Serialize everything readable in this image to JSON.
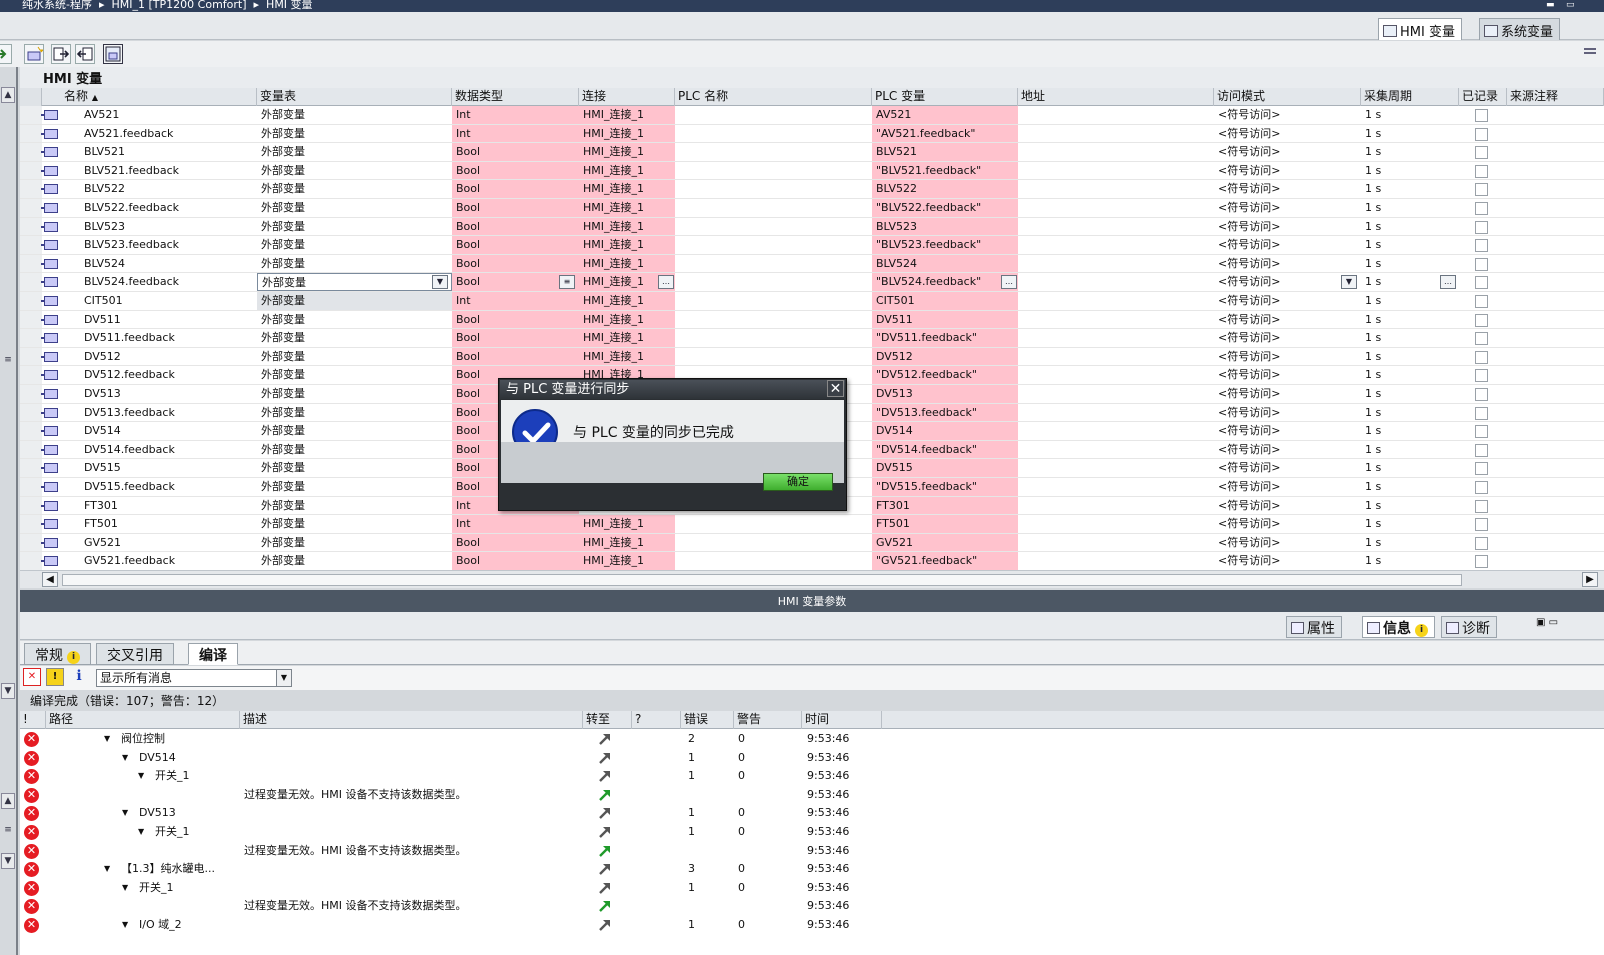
{
  "breadcrumb": [
    "纯水系统-程序",
    "HMI_1 [TP1200 Comfort]",
    "HMI 变量"
  ],
  "top_tabs": [
    "HMI 变量",
    "系统变量"
  ],
  "grid": {
    "title": "HMI 变量",
    "columns": [
      "名称",
      "变量表",
      "数据类型",
      "连接",
      "PLC 名称",
      "PLC 变量",
      "地址",
      "访问模式",
      "采集周期",
      "已记录",
      "来源注释"
    ],
    "sort_indicator": "▲",
    "rows": [
      {
        "name": "AV521",
        "table": "外部变量",
        "type": "Int",
        "conn": "HMI_连接_1",
        "plcvar": "AV521",
        "access": "<符号访问>",
        "cycle": "1 s"
      },
      {
        "name": "AV521.feedback",
        "table": "外部变量",
        "type": "Int",
        "conn": "HMI_连接_1",
        "plcvar": "\"AV521.feedback\"",
        "access": "<符号访问>",
        "cycle": "1 s"
      },
      {
        "name": "BLV521",
        "table": "外部变量",
        "type": "Bool",
        "conn": "HMI_连接_1",
        "plcvar": "BLV521",
        "access": "<符号访问>",
        "cycle": "1 s"
      },
      {
        "name": "BLV521.feedback",
        "table": "外部变量",
        "type": "Bool",
        "conn": "HMI_连接_1",
        "plcvar": "\"BLV521.feedback\"",
        "access": "<符号访问>",
        "cycle": "1 s"
      },
      {
        "name": "BLV522",
        "table": "外部变量",
        "type": "Bool",
        "conn": "HMI_连接_1",
        "plcvar": "BLV522",
        "access": "<符号访问>",
        "cycle": "1 s"
      },
      {
        "name": "BLV522.feedback",
        "table": "外部变量",
        "type": "Bool",
        "conn": "HMI_连接_1",
        "plcvar": "\"BLV522.feedback\"",
        "access": "<符号访问>",
        "cycle": "1 s"
      },
      {
        "name": "BLV523",
        "table": "外部变量",
        "type": "Bool",
        "conn": "HMI_连接_1",
        "plcvar": "BLV523",
        "access": "<符号访问>",
        "cycle": "1 s"
      },
      {
        "name": "BLV523.feedback",
        "table": "外部变量",
        "type": "Bool",
        "conn": "HMI_连接_1",
        "plcvar": "\"BLV523.feedback\"",
        "access": "<符号访问>",
        "cycle": "1 s"
      },
      {
        "name": "BLV524",
        "table": "外部变量",
        "type": "Bool",
        "conn": "HMI_连接_1",
        "plcvar": "BLV524",
        "access": "<符号访问>",
        "cycle": "1 s"
      },
      {
        "name": "BLV524.feedback",
        "table": "外部变量",
        "type": "Bool",
        "conn": "HMI_连接_1",
        "plcvar": "\"BLV524.feedback\"",
        "access": "<符号访问>",
        "cycle": "1 s",
        "selected": true
      },
      {
        "name": "CIT501",
        "table": "外部变量",
        "type": "Int",
        "conn": "HMI_连接_1",
        "plcvar": "CIT501",
        "access": "<符号访问>",
        "cycle": "1 s"
      },
      {
        "name": "DV511",
        "table": "外部变量",
        "type": "Bool",
        "conn": "HMI_连接_1",
        "plcvar": "DV511",
        "access": "<符号访问>",
        "cycle": "1 s"
      },
      {
        "name": "DV511.feedback",
        "table": "外部变量",
        "type": "Bool",
        "conn": "HMI_连接_1",
        "plcvar": "\"DV511.feedback\"",
        "access": "<符号访问>",
        "cycle": "1 s"
      },
      {
        "name": "DV512",
        "table": "外部变量",
        "type": "Bool",
        "conn": "HMI_连接_1",
        "plcvar": "DV512",
        "access": "<符号访问>",
        "cycle": "1 s"
      },
      {
        "name": "DV512.feedback",
        "table": "外部变量",
        "type": "Bool",
        "conn": "HMI_连接_1",
        "plcvar": "\"DV512.feedback\"",
        "access": "<符号访问>",
        "cycle": "1 s"
      },
      {
        "name": "DV513",
        "table": "外部变量",
        "type": "Bool",
        "conn": "",
        "plcvar": "DV513",
        "access": "<符号访问>",
        "cycle": "1 s"
      },
      {
        "name": "DV513.feedback",
        "table": "外部变量",
        "type": "Bool",
        "conn": "",
        "plcvar": "\"DV513.feedback\"",
        "access": "<符号访问>",
        "cycle": "1 s"
      },
      {
        "name": "DV514",
        "table": "外部变量",
        "type": "Bool",
        "conn": "",
        "plcvar": "DV514",
        "access": "<符号访问>",
        "cycle": "1 s"
      },
      {
        "name": "DV514.feedback",
        "table": "外部变量",
        "type": "Bool",
        "conn": "",
        "plcvar": "\"DV514.feedback\"",
        "access": "<符号访问>",
        "cycle": "1 s"
      },
      {
        "name": "DV515",
        "table": "外部变量",
        "type": "Bool",
        "conn": "",
        "plcvar": "DV515",
        "access": "<符号访问>",
        "cycle": "1 s"
      },
      {
        "name": "DV515.feedback",
        "table": "外部变量",
        "type": "Bool",
        "conn": "",
        "plcvar": "\"DV515.feedback\"",
        "access": "<符号访问>",
        "cycle": "1 s"
      },
      {
        "name": "FT301",
        "table": "外部变量",
        "type": "Int",
        "conn": "",
        "plcvar": "FT301",
        "access": "<符号访问>",
        "cycle": "1 s"
      },
      {
        "name": "FT501",
        "table": "外部变量",
        "type": "Int",
        "conn": "HMI_连接_1",
        "plcvar": "FT501",
        "access": "<符号访问>",
        "cycle": "1 s"
      },
      {
        "name": "GV521",
        "table": "外部变量",
        "type": "Bool",
        "conn": "HMI_连接_1",
        "plcvar": "GV521",
        "access": "<符号访问>",
        "cycle": "1 s"
      },
      {
        "name": "GV521.feedback",
        "table": "外部变量",
        "type": "Bool",
        "conn": "HMI_连接_1",
        "plcvar": "\"GV521.feedback\"",
        "access": "<符号访问>",
        "cycle": "1 s"
      }
    ]
  },
  "params_bar": "HMI 变量参数",
  "inspector_tabs": {
    "properties": "属性",
    "info": "信息",
    "diagnostics": "诊断"
  },
  "subtabs": [
    "常规",
    "交叉引用",
    "编译"
  ],
  "filter": {
    "selected": "显示所有消息"
  },
  "compile_summary": "编译完成（错误：107；警告：12）",
  "messages": {
    "columns": [
      "!",
      "路径",
      "描述",
      "转至",
      "?",
      "错误",
      "警告",
      "时间"
    ],
    "rows": [
      {
        "path": "阀位控制",
        "indent": 0,
        "arrow": "▼",
        "desc": "",
        "errors": "2",
        "warnings": "0",
        "time": "9:53:46",
        "green": false
      },
      {
        "path": "DV514",
        "indent": 1,
        "arrow": "▼",
        "desc": "",
        "errors": "1",
        "warnings": "0",
        "time": "9:53:46",
        "green": false
      },
      {
        "path": "开关_1",
        "indent": 2,
        "arrow": "▼",
        "desc": "",
        "errors": "1",
        "warnings": "0",
        "time": "9:53:46",
        "green": false
      },
      {
        "path": "",
        "indent": 3,
        "arrow": "",
        "desc": "过程变量无效。HMI 设备不支持该数据类型。",
        "errors": "",
        "warnings": "",
        "time": "9:53:46",
        "green": true
      },
      {
        "path": "DV513",
        "indent": 1,
        "arrow": "▼",
        "desc": "",
        "errors": "1",
        "warnings": "0",
        "time": "9:53:46",
        "green": false
      },
      {
        "path": "开关_1",
        "indent": 2,
        "arrow": "▼",
        "desc": "",
        "errors": "1",
        "warnings": "0",
        "time": "9:53:46",
        "green": false
      },
      {
        "path": "",
        "indent": 3,
        "arrow": "",
        "desc": "过程变量无效。HMI 设备不支持该数据类型。",
        "errors": "",
        "warnings": "",
        "time": "9:53:46",
        "green": true
      },
      {
        "path": "【1.3】纯水罐电...",
        "indent": 0,
        "arrow": "▼",
        "desc": "",
        "errors": "3",
        "warnings": "0",
        "time": "9:53:46",
        "green": false
      },
      {
        "path": "开关_1",
        "indent": 1,
        "arrow": "▼",
        "desc": "",
        "errors": "1",
        "warnings": "0",
        "time": "9:53:46",
        "green": false
      },
      {
        "path": "",
        "indent": 3,
        "arrow": "",
        "desc": "过程变量无效。HMI 设备不支持该数据类型。",
        "errors": "",
        "warnings": "",
        "time": "9:53:46",
        "green": true
      },
      {
        "path": "I/O 域_2",
        "indent": 1,
        "arrow": "▼",
        "desc": "",
        "errors": "1",
        "warnings": "0",
        "time": "9:53:46",
        "green": false
      }
    ]
  },
  "dialog": {
    "title": "与 PLC 变量进行同步",
    "message": "与 PLC 变量的同步已完成",
    "ok": "确定"
  },
  "colors": {
    "error_cell": "#ffc2cd",
    "title_bar": "#2e3e5a",
    "ok_button": "#5fcf4d"
  }
}
